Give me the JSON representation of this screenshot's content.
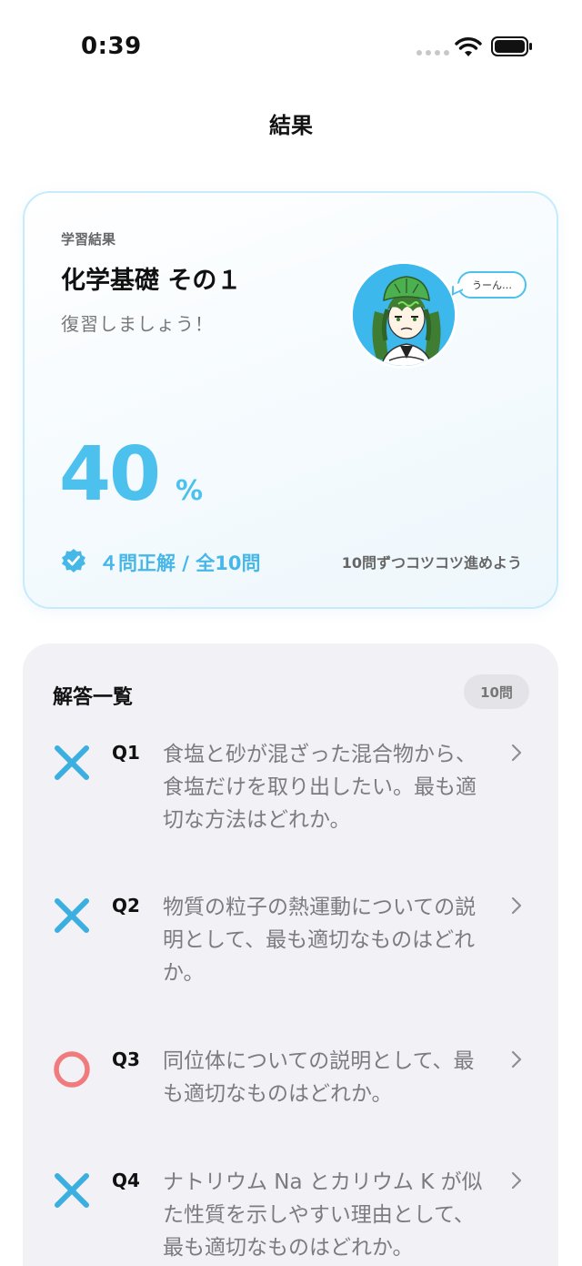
{
  "status": {
    "time": "0:39"
  },
  "nav": {
    "title": "結果"
  },
  "result": {
    "label": "学習結果",
    "quiz_title": "化学基礎 その１",
    "message": "復習しましょう！",
    "score": "40",
    "score_unit": "%",
    "correct_summary": "４問正解 / 全10問",
    "hint": "10問ずつコツコツ進めよう",
    "bubble_text": "うーん…",
    "accent_color": "#4cc1ee"
  },
  "answers": {
    "title": "解答一覧",
    "count": "10問",
    "items": [
      {
        "q": "Q1",
        "result": "incorrect",
        "text": "食塩と砂が混ざった混合物から、食塩だけを取り出したい。最も適切な方法はどれか。"
      },
      {
        "q": "Q2",
        "result": "incorrect",
        "text": "物質の粒子の熱運動についての説明として、最も適切なものはどれか。"
      },
      {
        "q": "Q3",
        "result": "correct",
        "text": "同位体についての説明として、最も適切なものはどれか。"
      },
      {
        "q": "Q4",
        "result": "incorrect",
        "text": "ナトリウム Na とカリウム K が似た性質を示しやすい理由として、最も適切なものはどれか。"
      }
    ],
    "incorrect_color": "#3bb0e0",
    "correct_color": "#f07a7c"
  }
}
